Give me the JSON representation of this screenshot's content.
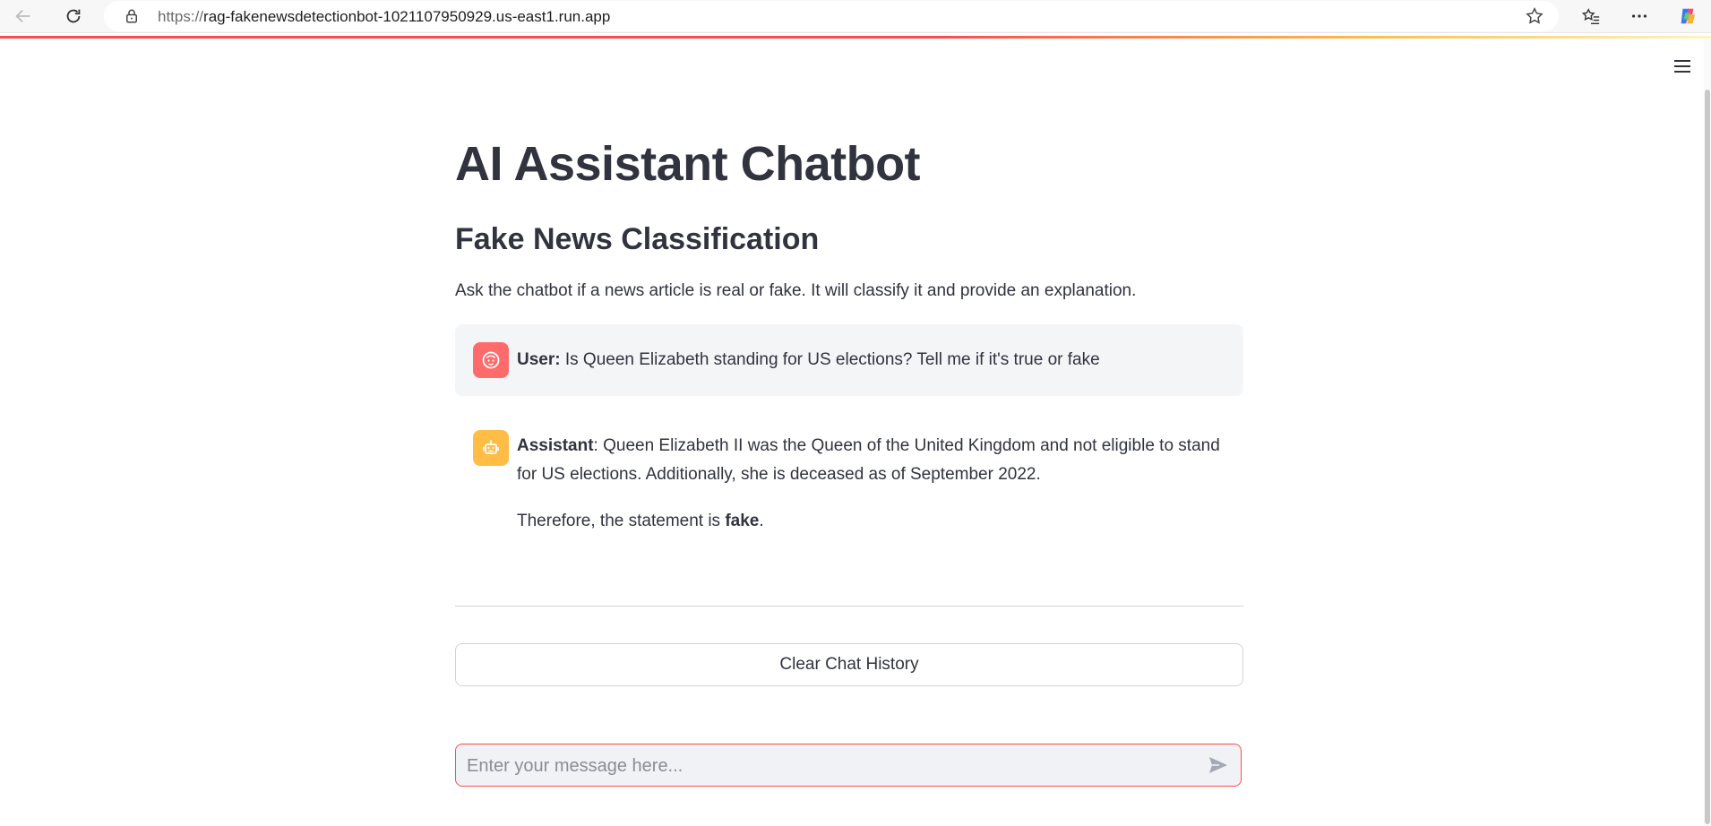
{
  "browser": {
    "url_scheme": "https://",
    "url_host": "rag-fakenewsdetectionbot-1021107950929.us-east1.run.app",
    "icons": [
      "back-icon",
      "reload-icon",
      "lock-icon",
      "star-icon",
      "favorites-icon",
      "more-icon",
      "copilot-icon"
    ]
  },
  "page": {
    "title": "AI Assistant Chatbot",
    "subtitle": "Fake News Classification",
    "intro": "Ask the chatbot if a news article is real or fake. It will classify it and provide an explanation."
  },
  "messages": {
    "user": {
      "role_label": "User",
      "text": "Is Queen Elizabeth standing for US elections? Tell me if it's true or fake"
    },
    "assistant": {
      "role_label": "Assistant",
      "text": "Queen Elizabeth II was the Queen of the United Kingdom and not eligible to stand for US elections. Additionally, she is deceased as of September 2022.",
      "conclusion_prefix": "Therefore, the statement is ",
      "conclusion_bold": "fake",
      "conclusion_suffix": "."
    }
  },
  "actions": {
    "clear_label": "Clear Chat History"
  },
  "chat_input": {
    "placeholder": "Enter your message here..."
  },
  "colors": {
    "accent": "#ff4b4b",
    "user_avatar": "#ff6b6b",
    "assistant_avatar": "#ffbd45"
  }
}
